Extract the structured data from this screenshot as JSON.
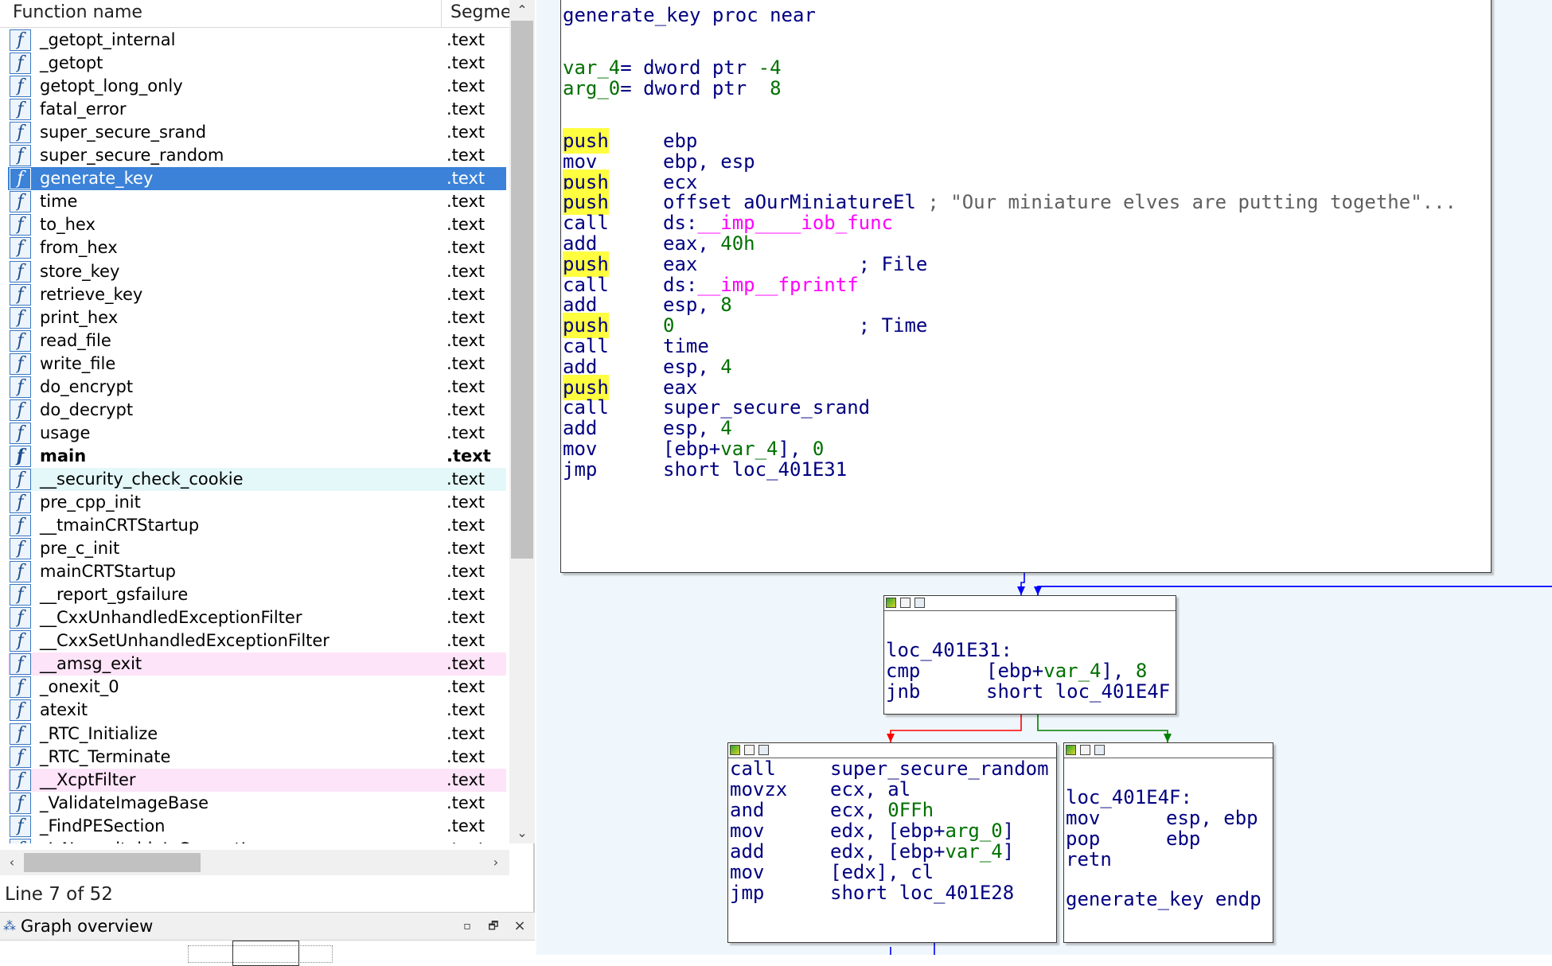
{
  "functions_pane": {
    "col_name": "Function name",
    "col_segment": "Segme",
    "icon_glyph": "f",
    "rows": [
      {
        "name": "_getopt_internal",
        "seg": ".text",
        "style": ""
      },
      {
        "name": "_getopt",
        "seg": ".text",
        "style": ""
      },
      {
        "name": "getopt_long_only",
        "seg": ".text",
        "style": ""
      },
      {
        "name": "fatal_error",
        "seg": ".text",
        "style": ""
      },
      {
        "name": "super_secure_srand",
        "seg": ".text",
        "style": ""
      },
      {
        "name": "super_secure_random",
        "seg": ".text",
        "style": ""
      },
      {
        "name": "generate_key",
        "seg": ".text",
        "style": "sel"
      },
      {
        "name": "time",
        "seg": ".text",
        "style": ""
      },
      {
        "name": "to_hex",
        "seg": ".text",
        "style": ""
      },
      {
        "name": "from_hex",
        "seg": ".text",
        "style": ""
      },
      {
        "name": "store_key",
        "seg": ".text",
        "style": ""
      },
      {
        "name": "retrieve_key",
        "seg": ".text",
        "style": ""
      },
      {
        "name": "print_hex",
        "seg": ".text",
        "style": ""
      },
      {
        "name": "read_file",
        "seg": ".text",
        "style": ""
      },
      {
        "name": "write_file",
        "seg": ".text",
        "style": ""
      },
      {
        "name": "do_encrypt",
        "seg": ".text",
        "style": ""
      },
      {
        "name": "do_decrypt",
        "seg": ".text",
        "style": ""
      },
      {
        "name": "usage",
        "seg": ".text",
        "style": ""
      },
      {
        "name": "main",
        "seg": ".text",
        "style": "bold"
      },
      {
        "name": "__security_check_cookie",
        "seg": ".text",
        "style": "cyan"
      },
      {
        "name": "pre_cpp_init",
        "seg": ".text",
        "style": ""
      },
      {
        "name": "__tmainCRTStartup",
        "seg": ".text",
        "style": ""
      },
      {
        "name": "pre_c_init",
        "seg": ".text",
        "style": ""
      },
      {
        "name": "mainCRTStartup",
        "seg": ".text",
        "style": ""
      },
      {
        "name": "__report_gsfailure",
        "seg": ".text",
        "style": ""
      },
      {
        "name": "__CxxUnhandledExceptionFilter",
        "seg": ".text",
        "style": ""
      },
      {
        "name": "__CxxSetUnhandledExceptionFilter",
        "seg": ".text",
        "style": ""
      },
      {
        "name": "__amsg_exit",
        "seg": ".text",
        "style": "pink"
      },
      {
        "name": "_onexit_0",
        "seg": ".text",
        "style": ""
      },
      {
        "name": "atexit",
        "seg": ".text",
        "style": ""
      },
      {
        "name": "_RTC_Initialize",
        "seg": ".text",
        "style": ""
      },
      {
        "name": "_RTC_Terminate",
        "seg": ".text",
        "style": ""
      },
      {
        "name": "__XcptFilter",
        "seg": ".text",
        "style": "pink"
      },
      {
        "name": "_ValidateImageBase",
        "seg": ".text",
        "style": ""
      },
      {
        "name": "_FindPESection",
        "seg": ".text",
        "style": ""
      },
      {
        "name": "_IsNonwritableInCurrentImage",
        "seg": ".text",
        "style": ""
      }
    ],
    "line_info": "Line 7 of 52",
    "scroll_up": "⌃",
    "scroll_down": "⌄",
    "scroll_left": "‹",
    "scroll_right": "›"
  },
  "graph_overview": {
    "title": "Graph overview",
    "icon": "⁂",
    "btn_float": "▫",
    "btn_restore": "🗗",
    "btn_close": "×"
  },
  "graph": {
    "colors": {
      "blue_edge": "#0000ff",
      "red_edge": "#ff0000",
      "green_edge": "#007f00",
      "highlight": "#ffff40"
    },
    "node_main": {
      "proc_name": "generate_key",
      "proc_kw": "proc near",
      "vars": [
        {
          "name": "var_4",
          "def": "= dword ptr ",
          "off": "-4"
        },
        {
          "name": "arg_0",
          "def": "= dword ptr  ",
          "off": "8"
        }
      ],
      "lines": [
        {
          "m": "push",
          "h": true,
          "parts": [
            {
              "t": "ebp",
              "c": "c-blue"
            }
          ]
        },
        {
          "m": "mov",
          "h": false,
          "parts": [
            {
              "t": "ebp, esp",
              "c": "c-blue"
            }
          ]
        },
        {
          "m": "push",
          "h": true,
          "parts": [
            {
              "t": "ecx",
              "c": "c-blue"
            }
          ]
        },
        {
          "m": "push",
          "h": true,
          "parts": [
            {
              "t": "offset aOurMiniatureEl",
              "c": "c-blue"
            },
            {
              "t": " ; \"Our miniature elves are putting togethe\"...",
              "c": "c-grey"
            }
          ]
        },
        {
          "m": "call",
          "h": false,
          "parts": [
            {
              "t": "ds:",
              "c": "c-blue"
            },
            {
              "t": "__imp____iob_func",
              "c": "c-pink"
            }
          ]
        },
        {
          "m": "add",
          "h": false,
          "parts": [
            {
              "t": "eax, ",
              "c": "c-blue"
            },
            {
              "t": "40h",
              "c": "c-green"
            }
          ]
        },
        {
          "m": "push",
          "h": true,
          "parts": [
            {
              "t": "eax",
              "c": "c-blue"
            },
            {
              "t": "              ; File",
              "c": "c-cmt"
            }
          ]
        },
        {
          "m": "call",
          "h": false,
          "parts": [
            {
              "t": "ds:",
              "c": "c-blue"
            },
            {
              "t": "__imp__fprintf",
              "c": "c-pink"
            }
          ]
        },
        {
          "m": "add",
          "h": false,
          "parts": [
            {
              "t": "esp, ",
              "c": "c-blue"
            },
            {
              "t": "8",
              "c": "c-green"
            }
          ]
        },
        {
          "m": "push",
          "h": true,
          "parts": [
            {
              "t": "0",
              "c": "c-green"
            },
            {
              "t": "                ; Time",
              "c": "c-cmt"
            }
          ]
        },
        {
          "m": "call",
          "h": false,
          "parts": [
            {
              "t": "time",
              "c": "c-blue"
            }
          ]
        },
        {
          "m": "add",
          "h": false,
          "parts": [
            {
              "t": "esp, ",
              "c": "c-blue"
            },
            {
              "t": "4",
              "c": "c-green"
            }
          ]
        },
        {
          "m": "push",
          "h": true,
          "parts": [
            {
              "t": "eax",
              "c": "c-blue"
            }
          ]
        },
        {
          "m": "call",
          "h": false,
          "parts": [
            {
              "t": "super_secure_srand",
              "c": "c-blue"
            }
          ]
        },
        {
          "m": "add",
          "h": false,
          "parts": [
            {
              "t": "esp, ",
              "c": "c-blue"
            },
            {
              "t": "4",
              "c": "c-green"
            }
          ]
        },
        {
          "m": "mov",
          "h": false,
          "parts": [
            {
              "t": "[ebp+",
              "c": "c-blue"
            },
            {
              "t": "var_4",
              "c": "c-green"
            },
            {
              "t": "], ",
              "c": "c-blue"
            },
            {
              "t": "0",
              "c": "c-green"
            }
          ]
        },
        {
          "m": "jmp",
          "h": false,
          "parts": [
            {
              "t": "short loc_401E31",
              "c": "c-blue"
            }
          ]
        }
      ]
    },
    "node_loop": {
      "label": "loc_401E31:",
      "lines": [
        {
          "m": "cmp",
          "h": false,
          "parts": [
            {
              "t": "[ebp+",
              "c": "c-blue"
            },
            {
              "t": "var_4",
              "c": "c-green"
            },
            {
              "t": "], ",
              "c": "c-blue"
            },
            {
              "t": "8",
              "c": "c-green"
            }
          ]
        },
        {
          "m": "jnb",
          "h": false,
          "parts": [
            {
              "t": "short loc_401E4F",
              "c": "c-blue"
            }
          ]
        }
      ]
    },
    "node_body": {
      "lines": [
        {
          "m": "call",
          "h": false,
          "parts": [
            {
              "t": "super_secure_random",
              "c": "c-blue"
            }
          ]
        },
        {
          "m": "movzx",
          "h": false,
          "parts": [
            {
              "t": "ecx, al",
              "c": "c-blue"
            }
          ]
        },
        {
          "m": "and",
          "h": false,
          "parts": [
            {
              "t": "ecx, ",
              "c": "c-blue"
            },
            {
              "t": "0FFh",
              "c": "c-green"
            }
          ]
        },
        {
          "m": "mov",
          "h": false,
          "parts": [
            {
              "t": "edx, [ebp+",
              "c": "c-blue"
            },
            {
              "t": "arg_0",
              "c": "c-green"
            },
            {
              "t": "]",
              "c": "c-blue"
            }
          ]
        },
        {
          "m": "add",
          "h": false,
          "parts": [
            {
              "t": "edx, [ebp+",
              "c": "c-blue"
            },
            {
              "t": "var_4",
              "c": "c-green"
            },
            {
              "t": "]",
              "c": "c-blue"
            }
          ]
        },
        {
          "m": "mov",
          "h": false,
          "parts": [
            {
              "t": "[edx], cl",
              "c": "c-blue"
            }
          ]
        },
        {
          "m": "jmp",
          "h": false,
          "parts": [
            {
              "t": "short loc_401E28",
              "c": "c-blue"
            }
          ]
        }
      ]
    },
    "node_exit": {
      "label": "loc_401E4F:",
      "lines": [
        {
          "m": "mov",
          "h": false,
          "parts": [
            {
              "t": "esp, ebp",
              "c": "c-blue"
            }
          ]
        },
        {
          "m": "pop",
          "h": false,
          "parts": [
            {
              "t": "ebp",
              "c": "c-blue"
            }
          ]
        },
        {
          "m": "retn",
          "h": false,
          "parts": []
        }
      ],
      "endp_name": "generate_key",
      "endp_kw": "endp"
    }
  }
}
